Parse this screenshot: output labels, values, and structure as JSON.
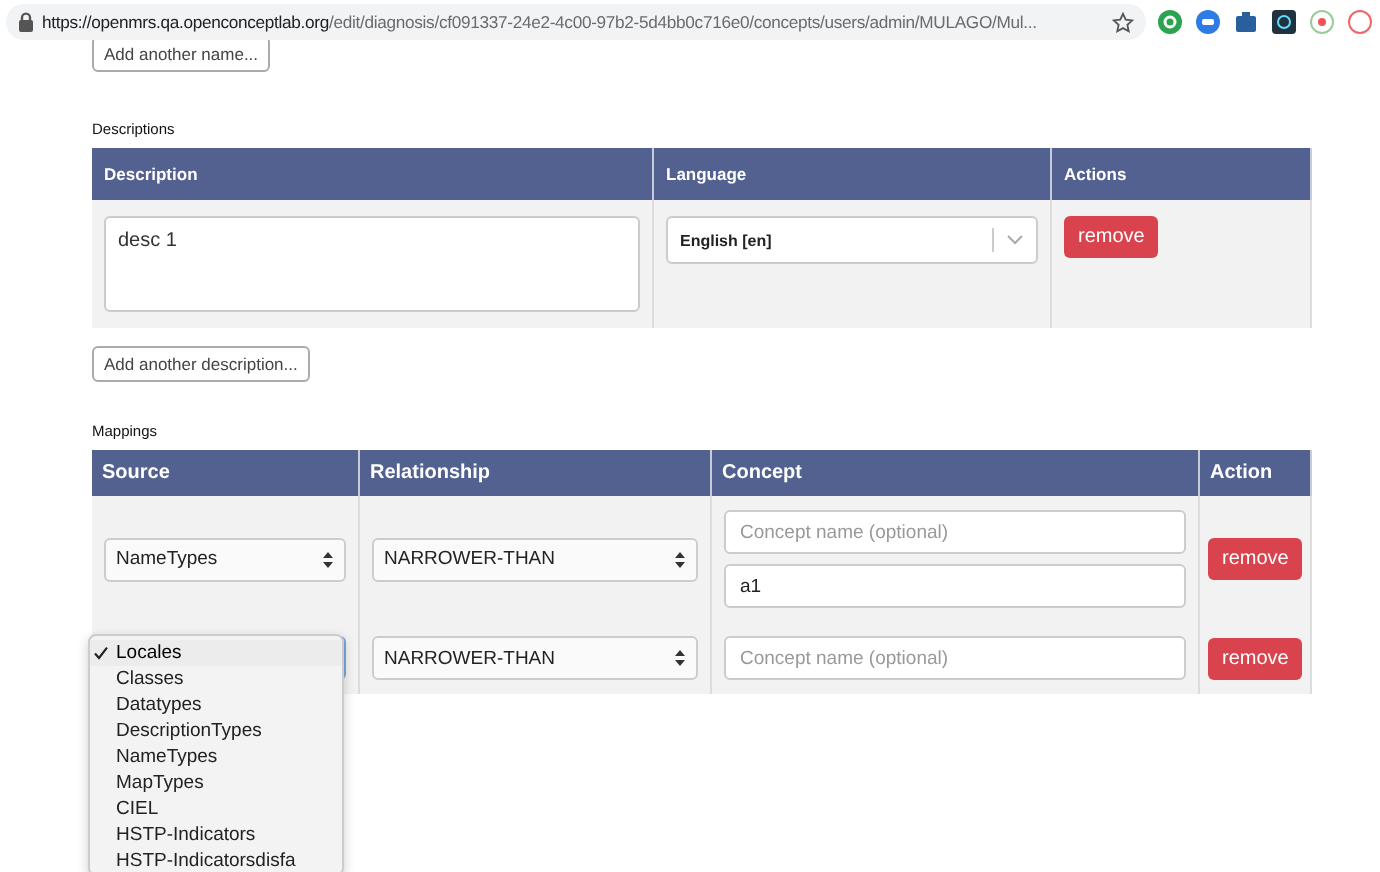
{
  "address_bar": {
    "host": "https://openmrs.qa.openconceptlab.org",
    "path": "/edit/diagnosis/cf091337-24e2-4c00-97b2-5d4bb0c716e0/concepts/users/admin/MULAGO/Mul..."
  },
  "add_name_button": "Add another name...",
  "descriptions": {
    "label": "Descriptions",
    "columns": [
      "Description",
      "Language",
      "Actions"
    ],
    "rows": [
      {
        "description": "desc 1",
        "language": "English [en]",
        "action": "remove"
      }
    ],
    "add_button": "Add another description..."
  },
  "mappings": {
    "label": "Mappings",
    "columns": [
      "Source",
      "Relationship",
      "Concept",
      "Action"
    ],
    "rows": [
      {
        "source": "NameTypes",
        "relationship": "NARROWER-THAN",
        "concept_placeholder": "Concept name (optional)",
        "code": "a1",
        "action": "remove"
      },
      {
        "relationship": "NARROWER-THAN",
        "concept_placeholder": "Concept name (optional)",
        "action": "remove"
      }
    ]
  },
  "source_menu": [
    {
      "label": "Locales",
      "selected": true
    },
    {
      "label": "Classes",
      "selected": false
    },
    {
      "label": "Datatypes",
      "selected": false
    },
    {
      "label": "DescriptionTypes",
      "selected": false
    },
    {
      "label": "NameTypes",
      "selected": false
    },
    {
      "label": "MapTypes",
      "selected": false
    },
    {
      "label": "CIEL",
      "selected": false
    },
    {
      "label": "HSTP-Indicators",
      "selected": false
    },
    {
      "label": "HSTP-Indicatorsdisfa",
      "selected": false
    }
  ]
}
